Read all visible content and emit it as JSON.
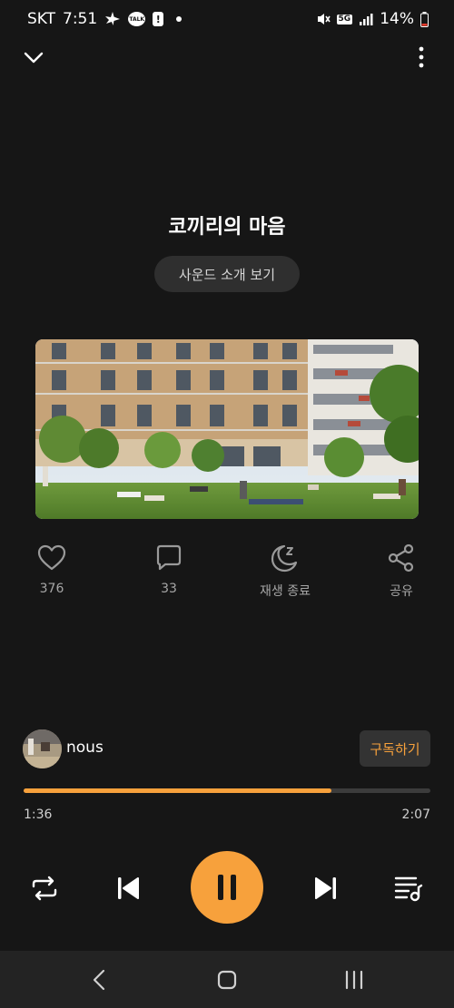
{
  "status_bar": {
    "carrier": "SKT",
    "time": "7:51",
    "talk_badge": "TALK",
    "alert_mark": "!",
    "network": "5G",
    "battery": "14%",
    "icons": [
      "plane-icon",
      "talk-icon",
      "alert-icon",
      "dot-icon",
      "mute-icon",
      "5g-icon",
      "signal-icon",
      "battery-icon"
    ]
  },
  "header": {
    "collapse_icon": "chevron-down-icon",
    "more_icon": "more-vertical-icon"
  },
  "track": {
    "title": "코끼리의 마음",
    "intro_button": "사운드 소개 보기"
  },
  "actions": [
    {
      "icon": "heart-icon",
      "label": "376"
    },
    {
      "icon": "comment-icon",
      "label": "33"
    },
    {
      "icon": "sleep-timer-icon",
      "label": "재생 종료"
    },
    {
      "icon": "share-icon",
      "label": "공유"
    }
  ],
  "artist": {
    "name": "nous",
    "subscribe_label": "구독하기"
  },
  "playback": {
    "current_time": "1:36",
    "total_time": "2:07",
    "progress": 0.756,
    "state": "playing"
  },
  "controls": {
    "icons": [
      "repeat-icon",
      "previous-icon",
      "pause-icon",
      "next-icon",
      "playlist-icon"
    ]
  },
  "nav": {
    "icons": [
      "back-icon",
      "home-icon",
      "recents-icon"
    ]
  },
  "colors": {
    "accent": "#f7a13c",
    "background": "#161616",
    "nav_background": "#232323"
  }
}
